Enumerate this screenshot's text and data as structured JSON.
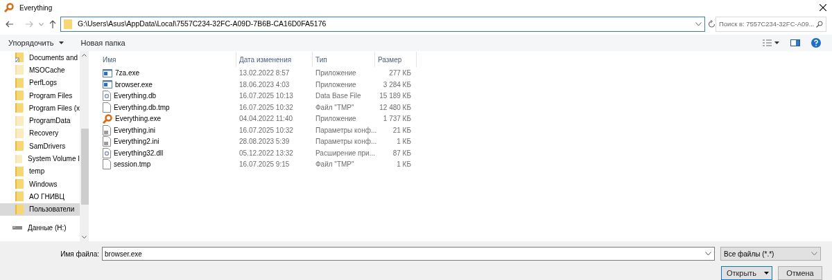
{
  "window": {
    "title": "Everything"
  },
  "address": {
    "path": "G:\\Users\\Asus\\AppData\\Local\\7557C234-32FC-A09D-7B6B-CA16D0FA5176"
  },
  "search": {
    "placeholder": "Поиск в: 7557C234-32FC-A09..."
  },
  "toolbar": {
    "organize": "Упорядочить",
    "new_folder": "Новая папка"
  },
  "sidebar": {
    "items": [
      {
        "label": "Documents and",
        "kind": "link",
        "selected": false
      },
      {
        "label": "MSOCache",
        "kind": "hidden",
        "selected": false
      },
      {
        "label": "PerfLogs",
        "kind": "folder",
        "selected": false
      },
      {
        "label": "Program Files",
        "kind": "folder",
        "selected": false
      },
      {
        "label": "Program Files (x",
        "kind": "folder",
        "selected": false
      },
      {
        "label": "ProgramData",
        "kind": "hidden",
        "selected": false
      },
      {
        "label": "Recovery",
        "kind": "hidden",
        "selected": false
      },
      {
        "label": "SamDrivers",
        "kind": "folder",
        "selected": false
      },
      {
        "label": "System Volume I",
        "kind": "hidden",
        "selected": false
      },
      {
        "label": "temp",
        "kind": "folder",
        "selected": false
      },
      {
        "label": "Windows",
        "kind": "folder",
        "selected": false
      },
      {
        "label": "АО ГНИВЦ",
        "kind": "folder",
        "selected": false
      },
      {
        "label": "Пользователи",
        "kind": "folder",
        "selected": true
      },
      {
        "label": "Данные (H:)",
        "kind": "drive",
        "selected": false
      }
    ]
  },
  "table": {
    "columns": [
      "Имя",
      "Дата изменения",
      "Тип",
      "Размер"
    ],
    "rows": [
      {
        "kind": "exe",
        "name": "7za.exe",
        "date": "13.02.2022 8:57",
        "type": "Приложение",
        "size": "277 КБ"
      },
      {
        "kind": "exe",
        "name": "browser.exe",
        "date": "18.06.2023 4:03",
        "type": "Приложение",
        "size": "3 284 КБ"
      },
      {
        "kind": "config",
        "name": "Everything.db",
        "date": "16.07.2025 10:13",
        "type": "Data Base File",
        "size": "15 189 КБ"
      },
      {
        "kind": "blank",
        "name": "Everything.db.tmp",
        "date": "16.07.2025 10:32",
        "type": "Файл \"TMP\"",
        "size": "12 480 КБ"
      },
      {
        "kind": "app",
        "name": "Everything.exe",
        "date": "04.04.2022 11:40",
        "type": "Приложение",
        "size": "1 737 КБ"
      },
      {
        "kind": "ini",
        "name": "Everything.ini",
        "date": "16.07.2025 10:32",
        "type": "Параметры конф...",
        "size": "21 КБ"
      },
      {
        "kind": "ini",
        "name": "Everything2.ini",
        "date": "28.08.2023 5:39",
        "type": "Параметры конф...",
        "size": "1 КБ"
      },
      {
        "kind": "config",
        "name": "Everything32.dll",
        "date": "05.12.2022 13:32",
        "type": "Расширение при...",
        "size": "87 КБ"
      },
      {
        "kind": "blank",
        "name": "session.tmp",
        "date": "16.07.2025 9:15",
        "type": "Файл \"TMP\"",
        "size": "1 КБ"
      }
    ]
  },
  "footer": {
    "filename_label": "Имя файла:",
    "filename": "browser.exe",
    "filter": "Все файлы (*.*)",
    "open": "Открыть",
    "cancel": "Отмена"
  }
}
